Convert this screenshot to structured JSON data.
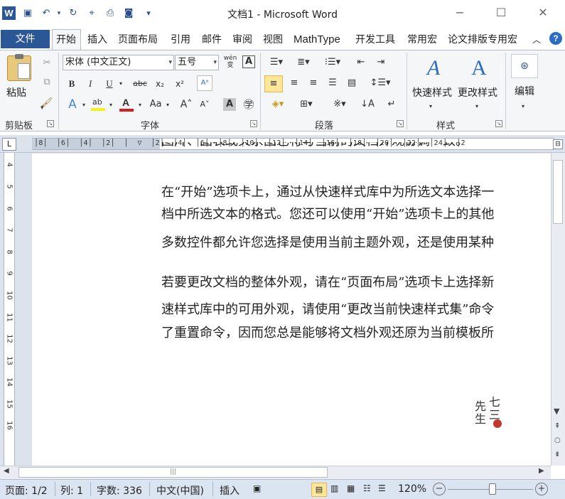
{
  "window": {
    "title": "文档1 - Microsoft Word",
    "app_icon": "W",
    "minimize_icon": "−",
    "maximize_icon": "☐",
    "close_icon": "✕"
  },
  "quick_access": {
    "save": "💾",
    "undo": "↶",
    "redo": "↻",
    "customize": "▾"
  },
  "tabs": {
    "file": "文件",
    "items": [
      "开始",
      "插入",
      "页面布局",
      "引用",
      "邮件",
      "审阅",
      "视图",
      "MathType",
      "开发工具",
      "常用宏",
      "论文排版专用宏"
    ],
    "collapse": "︿",
    "help": "?"
  },
  "ribbon": {
    "clipboard": {
      "paste": "粘贴",
      "group": "剪贴板"
    },
    "font": {
      "font_name": "宋体 (中文正文)",
      "font_size": "五号",
      "wen": "wén",
      "bold": "B",
      "italic": "I",
      "underline": "U",
      "strike": "abc",
      "subscript": "x₂",
      "superscript": "x²",
      "grow": "A˄",
      "shrink": "A˅",
      "change_case": "Aa",
      "group": "字体"
    },
    "paragraph": {
      "group": "段落"
    },
    "styles": {
      "quick": "快速样式",
      "change": "更改样式",
      "group": "样式"
    },
    "editing": {
      "label": "编辑"
    }
  },
  "ruler": {
    "tab_selector": "L",
    "marks": "│8│  │6│  │4│  │2│  │  ▽  │2│  │4│  │6│  │8│  │10│  │12│  │14│  │16│  │18│  │20│  │22│  │24│  │2"
  },
  "vertical_ruler": [
    "4",
    "5",
    "6",
    "7",
    "8",
    "9",
    "10",
    "11",
    "12",
    "13",
    "14",
    "15",
    "16"
  ],
  "document": {
    "cut_line": "图片、图表或关系图也将与当前的文档外观协调一致。",
    "paragraphs": [
      [
        "在“开始”选项卡上，通过从快速样式库中为所选文本选择一",
        "档中所选文本的格式。您还可以使用“开始”选项卡上的其他",
        "多数控件都允许您选择是使用当前主题外观，还是使用某种"
      ],
      [
        "若要更改文档的整体外观，请在“页面布局”选项卡上选择新",
        "速样式库中的可用外观，请使用“更改当前快速样式集”命令",
        "了重置命令，因而您总是能够将文档外观还原为当前模板所"
      ]
    ],
    "watermark": [
      "先",
      "七",
      "生",
      "三"
    ]
  },
  "status_bar": {
    "page": "页面: 1/2",
    "column": "列: 1",
    "words": "字数: 336",
    "language": "中文(中国)",
    "mode": "插入",
    "zoom": "120%"
  }
}
